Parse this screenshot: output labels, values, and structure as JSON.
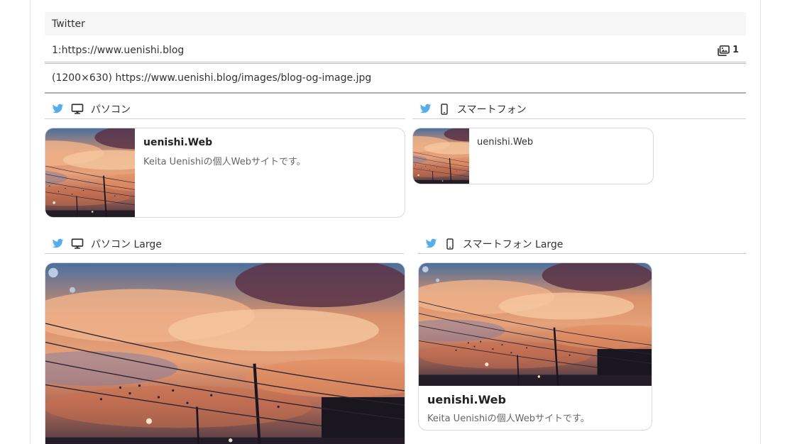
{
  "header": {
    "title": "Twitter"
  },
  "url_row": {
    "text": "1:https://www.uenishi.blog",
    "image_count": "1",
    "icon": "images-icon"
  },
  "image_row": {
    "text": "(1200×630) https://www.uenishi.blog/images/blog-og-image.jpg"
  },
  "sections": {
    "pc": {
      "label": "パソコン"
    },
    "sp": {
      "label": "スマートフォン"
    },
    "pc_large": {
      "label": "パソコン Large"
    },
    "sp_large": {
      "label": "スマートフォン Large"
    }
  },
  "card": {
    "site_name": "uenishi.Web",
    "description": "Keita Uenishiの個人Webサイトです。"
  },
  "colors": {
    "twitter_blue": "#55acee",
    "border": "#d9d9d9",
    "header_bg": "#f6f6f6"
  }
}
